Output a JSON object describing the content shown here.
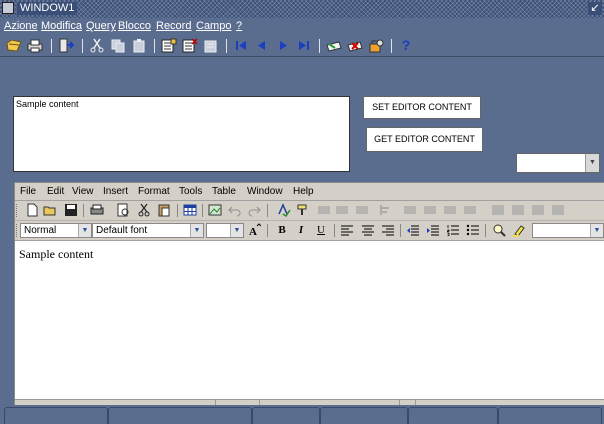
{
  "window": {
    "title": "WINDOW1",
    "control_glyph": "↙"
  },
  "menubar": {
    "items": [
      "Azione",
      "Modifica",
      "Query",
      "Blocco",
      "Record",
      "Campo",
      "?"
    ]
  },
  "toolbar": {
    "icons": [
      "save-icon",
      "print-icon",
      "exit-icon",
      "cut-icon",
      "copy-icon",
      "paste-icon",
      "insert-record-icon",
      "delete-record-icon",
      "clear-record-icon",
      "first-record-icon",
      "previous-record-icon",
      "next-record-icon",
      "last-record-icon",
      "insert-row-icon",
      "remove-row-icon",
      "lock-record-icon",
      "help-icon"
    ],
    "help_label": "?"
  },
  "form": {
    "textbox_value": "Sample content",
    "set_button_label": "SET EDITOR CONTENT",
    "get_button_label": "GET EDITOR CONTENT",
    "combo_value": ""
  },
  "editor": {
    "menu": [
      "File",
      "Edit",
      "View",
      "Insert",
      "Format",
      "Tools",
      "Table",
      "Window",
      "Help"
    ],
    "style_select": "Normal",
    "font_select": "Default font",
    "size_select": "",
    "size2_select": "",
    "color_select": "",
    "bold_label": "B",
    "italic_label": "I",
    "underline_label": "U",
    "content": "Sample content"
  },
  "colors": {
    "background": "#5b6d8f",
    "editor_chrome": "#d4d0c8",
    "nav_blue": "#1a3fbf"
  }
}
